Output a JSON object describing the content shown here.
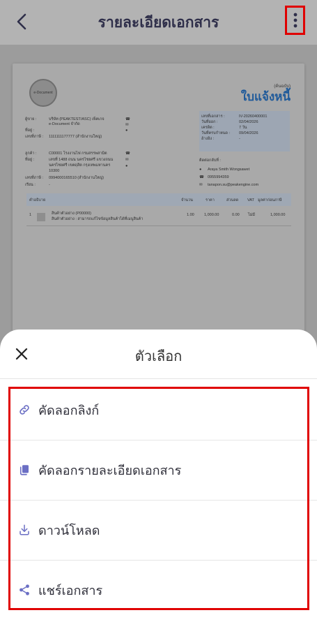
{
  "header": {
    "title": "รายละเอียดเอกสาร",
    "back_icon": "chevron-left-icon",
    "more_icon": "more-vertical-icon"
  },
  "document": {
    "original_label": "(ต้นฉบับ)",
    "doc_type": "ใบแจ้งหนี้",
    "logo_text": "e-Document",
    "seller": {
      "label_name": "ผู้ขาย :",
      "name_line1": "บริษัท (PEAKTEST/ASC) เพ็คเกจ",
      "name_line2": "e-Document จำกัด",
      "label_address": "ที่อยู่ :",
      "label_taxid": "เลขที่ภาษี :",
      "taxid": "1111111177777 (สำนักงานใหญ่)"
    },
    "customer": {
      "label_name": "ลูกค้า :",
      "name": "C00001 โรงงานไฟ กรมสรรพสามิต",
      "label_address": "ที่อยู่ :",
      "address_line1": "เลขที่ 1488 ถนน นครไชยศรี แขวงถนน",
      "address_line2": "นครไชยศรี เขตดุสิต กรุงเทพมหานคร",
      "address_line3": "10300",
      "label_taxid": "เลขที่ภาษี :",
      "taxid": "0994000165510 (สำนักงานใหญ่)",
      "label_attn": "เรียน :",
      "attn": "-"
    },
    "info": {
      "label_docno": "เลขที่เอกสาร :",
      "docno": "IV-20260400001",
      "label_issue": "วันที่ออก :",
      "issue": "02/04/2026",
      "label_credit": "เครดิต :",
      "credit": "7 วัน",
      "label_due": "วันที่ครบกำหนด :",
      "due": "09/04/2026",
      "label_ref": "อ้างอิง :",
      "ref": "-"
    },
    "contact": {
      "label": "ติดต่อกลับที่ :",
      "name": "Araya Smith Wongsawet",
      "phone": "0955994359",
      "email": "tanapon.su@peakengine.com"
    },
    "table": {
      "headers": [
        "คำอธิบาย",
        "จำนวน",
        "ราคา",
        "ส่วนลด",
        "VAT",
        "มูลค่าก่อนภาษี"
      ],
      "row": {
        "no": "1",
        "name": "สินค้าตัวอย่าง (P00000)",
        "desc": "สินค้าตัวอย่าง : สามารถแก้ไขข้อมูลสินค้าได้ที่เมนูสินค้า",
        "qty": "1.00",
        "price": "1,000.00",
        "discount": "0.00",
        "vat": "ไม่มี",
        "amount": "1,000.00"
      }
    }
  },
  "sheet": {
    "title": "ตัวเลือก",
    "close_icon": "close-icon",
    "accent_color": "#6b6fc4",
    "options": [
      {
        "label": "คัดลอกลิงก์",
        "icon": "link-icon"
      },
      {
        "label": "คัดลอกรายละเอียดเอกสาร",
        "icon": "copy-icon"
      },
      {
        "label": "ดาวน์โหลด",
        "icon": "download-icon"
      },
      {
        "label": "แชร์เอกสาร",
        "icon": "share-icon"
      }
    ]
  }
}
